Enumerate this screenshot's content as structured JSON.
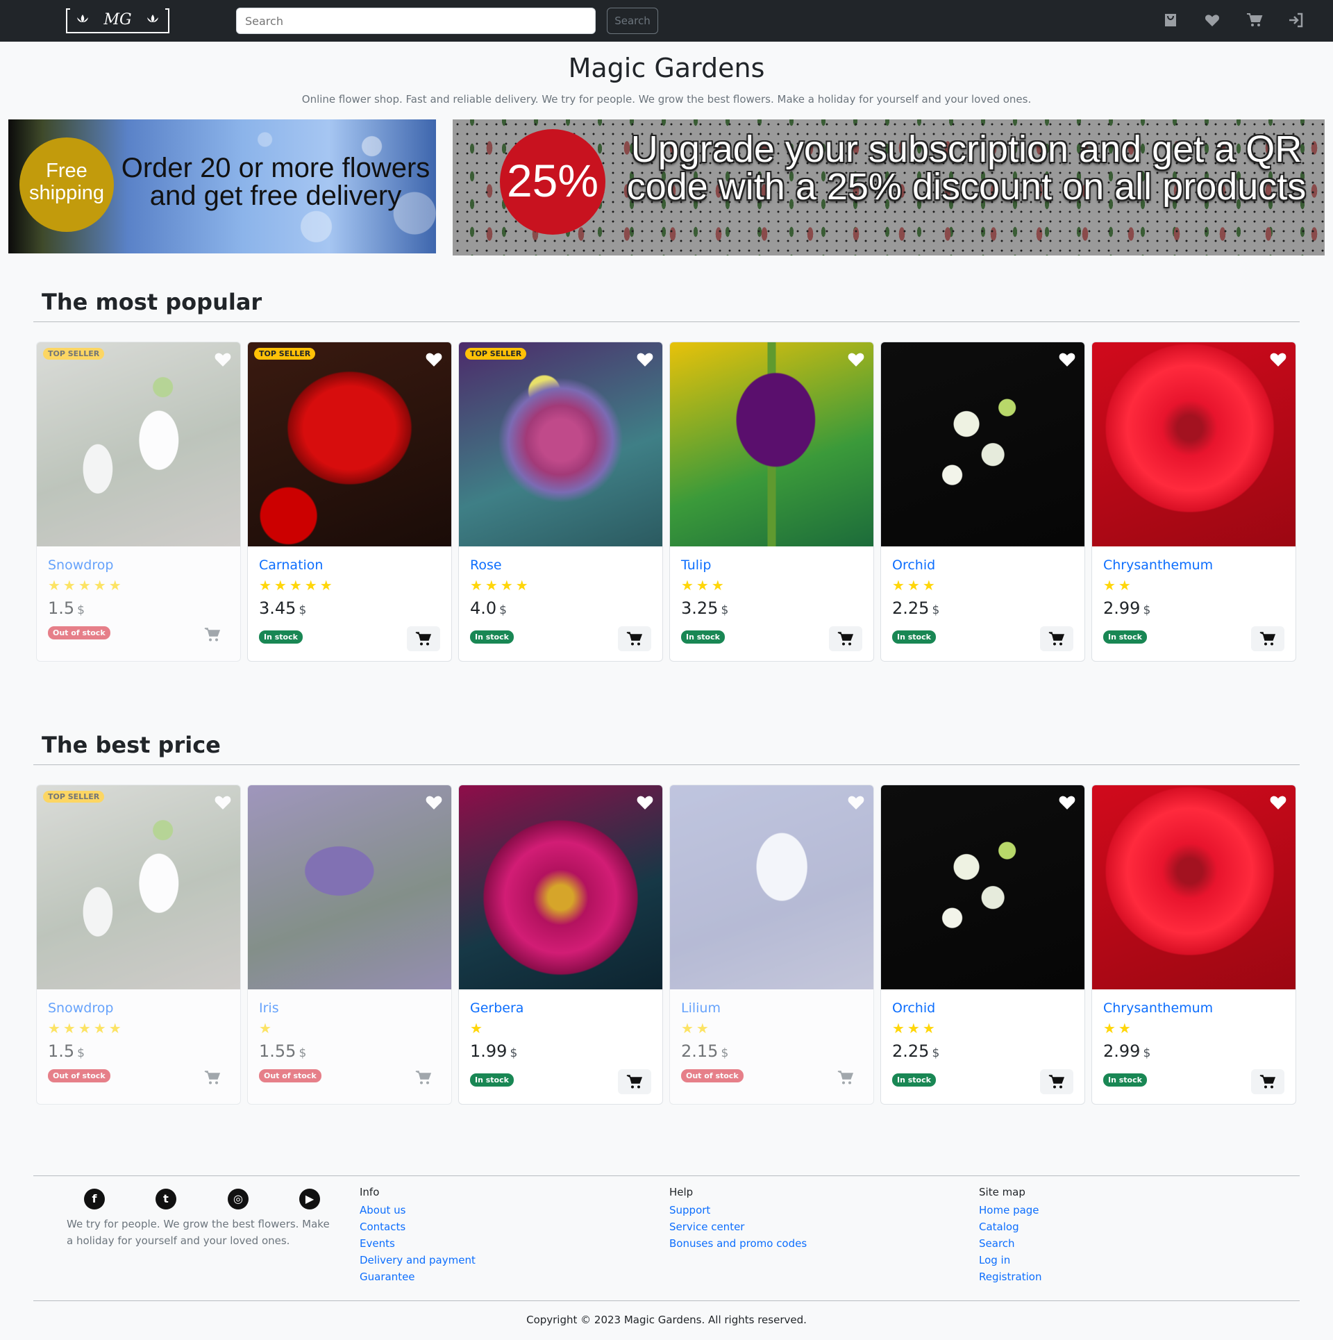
{
  "nav": {
    "logo_text": "MG",
    "search_placeholder": "Search",
    "search_button": "Search",
    "icons": [
      "bag-icon",
      "heart-icon",
      "cart-icon",
      "login-icon"
    ]
  },
  "header": {
    "title": "Magic Gardens",
    "subtitle": "Online flower shop. Fast and reliable delivery. We try for people. We grow the best flowers. Make a holiday for yourself and your loved ones."
  },
  "banners": {
    "left_badge": "Free shipping",
    "left_text": "Order 20 or more flowers and get free delivery",
    "right_badge": "25%",
    "right_text": "Upgrade your subscription and get a QR code with a 25% discount on all products"
  },
  "sections": [
    {
      "title": "The most popular",
      "cards": [
        {
          "name": "Snowdrop",
          "rating": 5,
          "stars": "★★★★★",
          "price": "1.5",
          "currency": "$",
          "status": "Out of stock",
          "top_seller": "TOP SELLER"
        },
        {
          "name": "Carnation",
          "rating": 5,
          "stars": "★★★★★",
          "price": "3.45",
          "currency": "$",
          "status": "In stock",
          "top_seller": "TOP SELLER"
        },
        {
          "name": "Rose",
          "rating": 4,
          "stars": "★★★★",
          "price": "4.0",
          "currency": "$",
          "status": "In stock",
          "top_seller": "TOP SELLER"
        },
        {
          "name": "Tulip",
          "rating": 3,
          "stars": "★★★",
          "price": "3.25",
          "currency": "$",
          "status": "In stock",
          "top_seller": ""
        },
        {
          "name": "Orchid",
          "rating": 3,
          "stars": "★★★",
          "price": "2.25",
          "currency": "$",
          "status": "In stock",
          "top_seller": ""
        },
        {
          "name": "Chrysanthemum",
          "rating": 2,
          "stars": "★★",
          "price": "2.99",
          "currency": "$",
          "status": "In stock",
          "top_seller": ""
        }
      ]
    },
    {
      "title": "The best price",
      "cards": [
        {
          "name": "Snowdrop",
          "rating": 5,
          "stars": "★★★★★",
          "price": "1.5",
          "currency": "$",
          "status": "Out of stock",
          "top_seller": "TOP SELLER"
        },
        {
          "name": "Iris",
          "rating": 1,
          "stars": "★",
          "price": "1.55",
          "currency": "$",
          "status": "Out of stock",
          "top_seller": ""
        },
        {
          "name": "Gerbera",
          "rating": 1,
          "stars": "★",
          "price": "1.99",
          "currency": "$",
          "status": "In stock",
          "top_seller": ""
        },
        {
          "name": "Lilium",
          "rating": 2,
          "stars": "★★",
          "price": "2.15",
          "currency": "$",
          "status": "Out of stock",
          "top_seller": ""
        },
        {
          "name": "Orchid",
          "rating": 3,
          "stars": "★★★",
          "price": "2.25",
          "currency": "$",
          "status": "In stock",
          "top_seller": ""
        },
        {
          "name": "Chrysanthemum",
          "rating": 2,
          "stars": "★★",
          "price": "2.99",
          "currency": "$",
          "status": "In stock",
          "top_seller": ""
        }
      ]
    }
  ],
  "footer": {
    "social": [
      "facebook-icon",
      "twitter-icon",
      "instagram-icon",
      "youtube-icon"
    ],
    "about": "We try for people. We grow the best flowers. Make a holiday for yourself and your loved ones.",
    "columns": [
      {
        "title": "Info",
        "links": [
          "About us",
          "Contacts",
          "Events",
          "Delivery and payment",
          "Guarantee"
        ]
      },
      {
        "title": "Help",
        "links": [
          "Support",
          "Service center",
          "Bonuses and promo codes"
        ]
      },
      {
        "title": "Site map",
        "links": [
          "Home page",
          "Catalog",
          "Search",
          "Log in",
          "Registration"
        ]
      }
    ],
    "copyright": "Copyright © 2023 Magic Gardens. All rights reserved."
  },
  "colors": {
    "navbar": "#212529",
    "link": "#0d6efd",
    "in_stock": "#198754",
    "out_of_stock": "#dc3545",
    "top_seller": "#ffc107",
    "star": "#ffd60a"
  }
}
